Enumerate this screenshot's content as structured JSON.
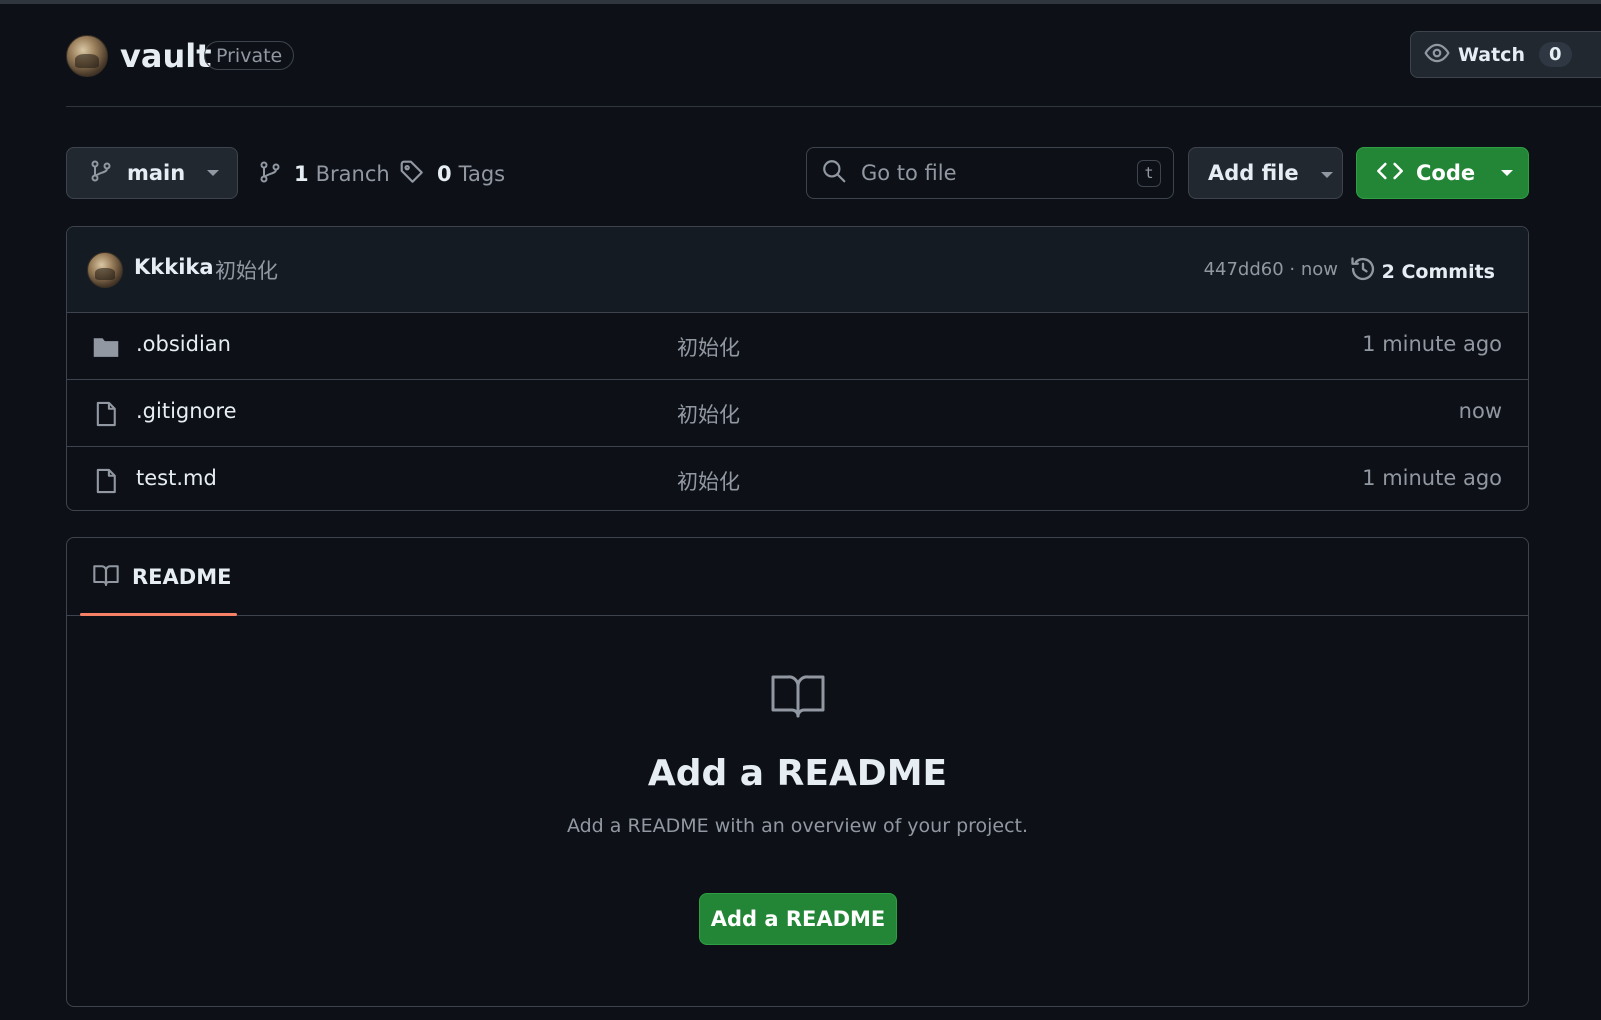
{
  "repo": {
    "name": "vault",
    "visibility": "Private",
    "avatar_icon": "user-avatar"
  },
  "watch": {
    "label": "Watch",
    "count": "0",
    "icon": "eye-icon"
  },
  "toolbar": {
    "branch_label": "main",
    "branch_count": "1",
    "branch_text": "Branch",
    "tag_count": "0",
    "tag_text": "Tags",
    "search_placeholder": "Go to file",
    "search_shortcut": "t",
    "add_file_label": "Add file",
    "code_label": "Code"
  },
  "latest_commit": {
    "author": "Kkkika",
    "message": "初始化",
    "sha_time": "447dd60 · now",
    "commits_label": "2 Commits"
  },
  "files": [
    {
      "name": ".obsidian",
      "type": "folder",
      "commit": "初始化",
      "time": "1 minute ago"
    },
    {
      "name": ".gitignore",
      "type": "file",
      "commit": "初始化",
      "time": "now"
    },
    {
      "name": "test.md",
      "type": "file",
      "commit": "初始化",
      "time": "1 minute ago"
    }
  ],
  "readme": {
    "tab_label": "README",
    "empty_title": "Add a README",
    "empty_desc": "Add a README with an overview of your project.",
    "button_label": "Add a README"
  },
  "colors": {
    "background": "#0d1117",
    "border": "#3d444d",
    "muted_text": "#9198a1",
    "primary_text": "#e6edf3",
    "green_button": "#238636",
    "tab_underline": "#f78166"
  }
}
